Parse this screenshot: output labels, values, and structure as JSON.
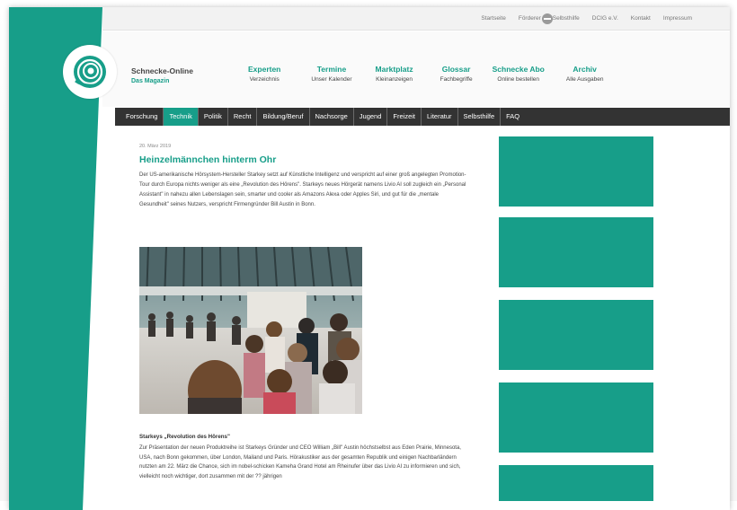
{
  "topbar": {
    "links": [
      "Startseite",
      "Förderer der Selbsthilfe",
      "DCIG e.V.",
      "Kontakt",
      "Impressum"
    ],
    "icon": "globe-icon"
  },
  "brand": {
    "name": "Schnecke-Online",
    "subtitle": "Das Magazin",
    "logo_icon": "spiral-snail-logo"
  },
  "mainnav": [
    {
      "title": "Experten",
      "sub": "Verzeichnis"
    },
    {
      "title": "Termine",
      "sub": "Unser Kalender"
    },
    {
      "title": "Marktplatz",
      "sub": "Kleinanzeigen"
    },
    {
      "title": "Glossar",
      "sub": "Fachbegriffe"
    },
    {
      "title": "Schnecke Abo",
      "sub": "Online bestellen"
    },
    {
      "title": "Archiv",
      "sub": "Alle Ausgaben"
    }
  ],
  "categories": [
    "Forschung",
    "Technik",
    "Politik",
    "Recht",
    "Bildung/Beruf",
    "Nachsorge",
    "Jugend",
    "Freizeit",
    "Literatur",
    "Selbsthilfe",
    "FAQ"
  ],
  "active_category": "Technik",
  "article": {
    "date": "20. März 2019",
    "headline": "Heinzelmännchen hinterm Ohr",
    "intro": "Der US-amerikanische Hörsystem-Hersteller Starkey setzt auf Künstliche Intelligenz und verspricht auf einer groß angelegten Promotion-Tour durch Europa nichts weniger als eine „Revolution des Hörens\". Starkeys neues Hörgerät namens Livio AI soll zugleich ein „Personal Assistant\" in nahezu allen Lebenslagen sein, smarter und cooler als Amazons Alexa oder Apples Siri, und gut für die „mentale Gesundheit\" seines Nutzers, verspricht Firmengründer Bill Austin in Bonn.",
    "subhead": "Starkeys „Revolution des Hörens\"",
    "body": "Zur Präsentation der neuen Produktreihe ist Starkeys Gründer und CEO William „Bill\" Austin höchstselbst aus Eden Prairie, Minnesota, USA, nach Bonn gekommen, über London, Mailand und Paris. Hörakustiker aus der gesamten Republik und einigen Nachbarländern nutzten am 22. März die Chance, sich im nobel-schicken Kameha Grand Hotel am Rheinufer über das Livio AI zu informieren und sich, vielleicht noch wichtiger, dort zusammen mit der ?? jährigen"
  },
  "colors": {
    "accent": "#179e89",
    "catbar": "#333333",
    "page_bg": "#ffffff"
  }
}
